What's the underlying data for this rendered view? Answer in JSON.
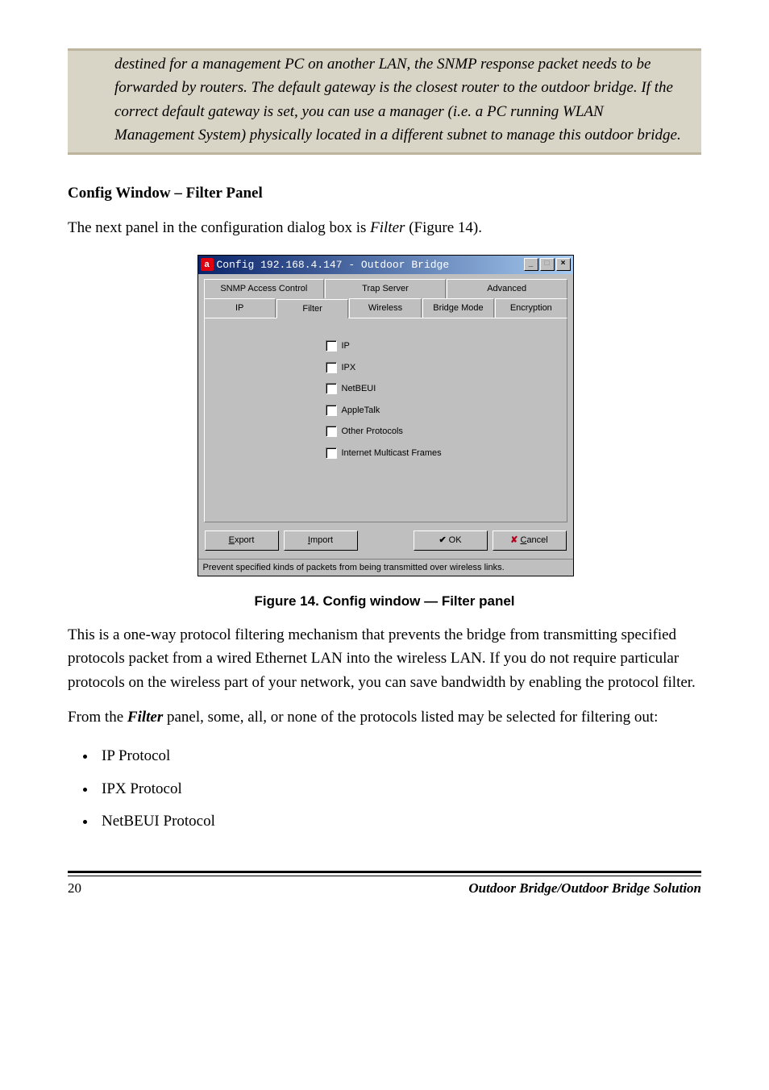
{
  "note": {
    "text": "destined for a management PC on another LAN, the SNMP response packet needs to be forwarded by routers. The default gateway is the closest router to the outdoor bridge. If the correct default gateway is set, you can use a manager (i.e. a PC running WLAN Management System) physically located in a different subnet to manage this outdoor bridge."
  },
  "section_heading": "Config Window – Filter Panel",
  "intro_prefix": "The next panel in the configuration dialog box is ",
  "intro_em": "Filter",
  "intro_suffix": " (Figure 14).",
  "window": {
    "title": "Config 192.168.4.147 - Outdoor Bridge",
    "tabs_back": [
      "SNMP Access Control",
      "Trap Server",
      "Advanced"
    ],
    "tabs_front": [
      "IP",
      "Filter",
      "Wireless",
      "Bridge Mode",
      "Encryption"
    ],
    "active_tab": "Filter",
    "checkboxes": [
      "IP",
      "IPX",
      "NetBEUI",
      "AppleTalk",
      "Other Protocols",
      "Internet Multicast Frames"
    ],
    "buttons": {
      "export": "Export",
      "import": "Import",
      "ok": "OK",
      "cancel": "Cancel"
    },
    "statusbar": "Prevent specified kinds of packets from being transmitted over wireless links."
  },
  "figure_caption": "Figure 14.  Config window — Filter panel",
  "para2_a": "This is a one-way protocol filtering mechanism that prevents the bridge from transmitting specified protocols packet from a wired Ethernet LAN into the wireless LAN. If you do not require particular protocols on the wireless part of your network, you can save bandwidth by enabling the protocol filter.",
  "para3_prefix": "From the ",
  "para3_em": "Filter",
  "para3_suffix": " panel, some, all, or none of the protocols listed may be selected for filtering out:",
  "bullets": [
    "IP Protocol",
    "IPX Protocol",
    "NetBEUI Protocol"
  ],
  "footer": {
    "page": "20",
    "title": "Outdoor Bridge/Outdoor Bridge Solution"
  }
}
